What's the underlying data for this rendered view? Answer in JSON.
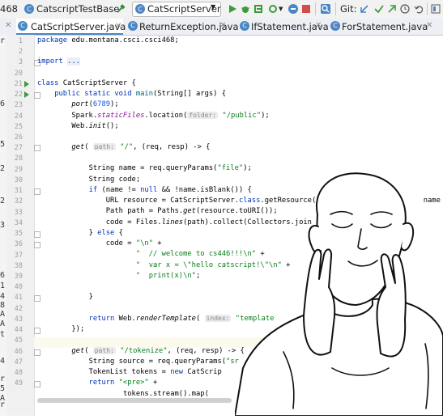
{
  "toolbar": {
    "project_fragment": "468",
    "project_name": "CatscriptTestBase",
    "run_config": "CatScriptServer",
    "vcs_label": "Git:"
  },
  "tabs": [
    {
      "label": "CatScriptServer.java",
      "active": true
    },
    {
      "label": "ReturnException.java",
      "active": false
    },
    {
      "label": "IfStatement.java",
      "active": false
    },
    {
      "label": "ForStatement.java",
      "active": false
    }
  ],
  "left_strip_letters": [
    "r",
    "6",
    "5",
    "2",
    "2",
    "3",
    "6",
    "1",
    "4",
    "8",
    "A",
    "A",
    "t",
    "4",
    "r",
    "5",
    "A",
    "5",
    "7",
    "r"
  ],
  "line_numbers": [
    "1",
    "2",
    "3",
    "20",
    "21",
    "22",
    "23",
    "24",
    "25",
    "26",
    "27",
    "28",
    "29",
    "30",
    "31",
    "32",
    "33",
    "34",
    "35",
    "36",
    "37",
    "38",
    "39",
    "40",
    "41",
    "42",
    "43",
    "44",
    "45",
    "46",
    "47",
    "48",
    "49"
  ],
  "code": {
    "l1_kw": "package",
    "l1_rest": " edu.montana.csci.csci468;",
    "l3_kw": "import",
    "l3_fold": "...",
    "l21_kw": "class",
    "l21_rest": " CatScriptServer {",
    "l22_kw": "public static void",
    "l22_fn": "main",
    "l22_rest": "(String[] args) {",
    "l23_fn": "port",
    "l23_num": "6789",
    "l23_end": ");",
    "l24_a": "Spark.",
    "l24_fld": "staticFiles",
    "l24_b": ".location(",
    "l24_hint": "folder:",
    "l24_str": "\"/public\"",
    "l24_end": ");",
    "l25_a": "Web.",
    "l25_fn": "init",
    "l25_end": "();",
    "l27_fn": "get",
    "l27_hint": "path:",
    "l27_str": "\"/\"",
    "l27_rest": ", (req, resp) -> {",
    "l29_a": "String name = req.queryParams(",
    "l29_str": "\"file\"",
    "l29_end": ");",
    "l30": "String code;",
    "l31_kw": "if",
    "l31_a": " (name != ",
    "l31_kw2": "null",
    "l31_b": " && !name.isBlank()) {",
    "l32_a": "URL resource = CatScriptServer.",
    "l32_kw": "class",
    "l32_b": ".getResource(",
    "l32_c": "name );",
    "l33_a": "Path path = Paths.",
    "l33_fn": "get",
    "l33_b": "(resource.toURI());",
    "l34_a": "code = Files.",
    "l34_fn": "lines",
    "l34_b": "(path).collect(Collectors.join",
    "l35_a": "} ",
    "l35_kw": "else",
    "l35_b": " {",
    "l36_a": "code = ",
    "l36_str": "\"\\n\"",
    "l36_b": " +",
    "l37_str": "\"  // welcome to cs446!!!\\n\"",
    "l37_b": " +",
    "l38_str": "\"  var x = \\\"hello catscript!\\\"\\n\"",
    "l38_b": " +",
    "l39_str": "\"  print(x)\\n\"",
    "l39_b": ";",
    "l40": "}",
    "l42_kw": "return",
    "l42_a": " Web.",
    "l42_fn": "renderTemplate",
    "l42_b": "(",
    "l42_hint": "index:",
    "l42_str": "\"template",
    "l43": "});",
    "l45_fn": "get",
    "l45_hint": "path:",
    "l45_str": "\"/tokenize\"",
    "l45_rest": ", (req, resp) -> {",
    "l46_a": "String source = req.queryParams(",
    "l46_str": "\"sr",
    "l47_a": "TokenList tokens = ",
    "l47_kw": "new",
    "l47_b": " CatScrip",
    "l48_kw": "return",
    "l48_str": "\"<pre>\"",
    "l48_b": " +",
    "l49": "tokens.stream().map("
  },
  "colors": {
    "keyword": "#0033b3",
    "string": "#067d17",
    "number": "#1750eb",
    "function": "#00627a",
    "field": "#871094",
    "tab_accent": "#4a86c5"
  },
  "icons": [
    "hammer-icon",
    "run-icon",
    "debug-icon",
    "coverage-icon",
    "profile-icon",
    "stop-icon",
    "search-icon",
    "git-update-icon",
    "git-commit-icon",
    "history-icon",
    "revert-icon",
    "class-icon",
    "meme-illustration"
  ]
}
